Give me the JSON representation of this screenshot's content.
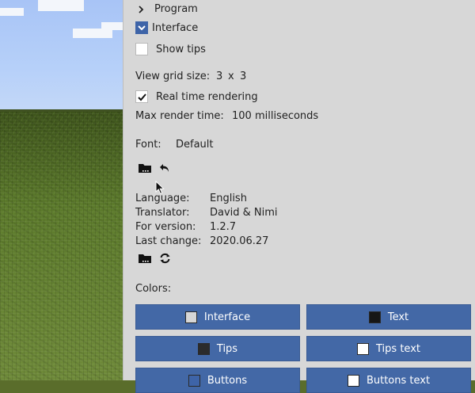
{
  "settings": {
    "program_label": "Program",
    "interface_label": "Interface",
    "show_tips_label": "Show tips",
    "show_tips_checked": false,
    "grid": {
      "label": "View grid size:",
      "x": "3",
      "sep": "x",
      "y": "3"
    },
    "realtime_label": "Real time rendering",
    "realtime_checked": true,
    "max_render": {
      "label": "Max render time:",
      "value": "100 milliseconds"
    },
    "font": {
      "label": "Font:",
      "value": "Default"
    },
    "language": {
      "language_label": "Language:",
      "language_value": "English",
      "translator_label": "Translator:",
      "translator_value": "David & Nimi",
      "version_label": "For version:",
      "version_value": "1.2.7",
      "lastchange_label": "Last change:",
      "lastchange_value": "2020.06.27"
    },
    "colors": {
      "label": "Colors:",
      "buttons": [
        {
          "label": "Interface",
          "swatch": "#d6d6d6"
        },
        {
          "label": "Text",
          "swatch": "#161616"
        },
        {
          "label": "Tips",
          "swatch": "#2b2b2b"
        },
        {
          "label": "Tips text",
          "swatch": "#ffffff"
        },
        {
          "label": "Buttons",
          "swatch": "#3e64a8"
        },
        {
          "label": "Buttons text",
          "swatch": "#ffffff"
        }
      ]
    }
  },
  "icons": {
    "folder": "folder-icon",
    "reset": "undo-icon",
    "refresh": "refresh-icon"
  }
}
